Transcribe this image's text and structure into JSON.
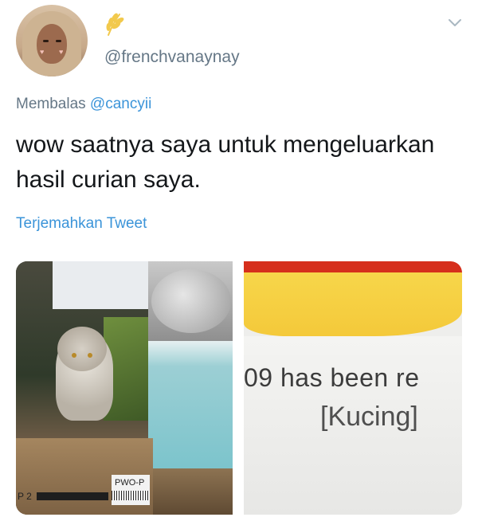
{
  "user": {
    "handle": "@frenchvanaynay",
    "avatar_icon": "profile-avatar",
    "badge_icon": "wheat-icon",
    "menu_icon": "chevron-down-icon"
  },
  "reply": {
    "prefix": "Membalas ",
    "mention": "@cancyii"
  },
  "tweet": {
    "text": "wow saatnya saya untuk mengeluarkan hasil curian saya."
  },
  "translate_label": "Terjemahkan Tweet",
  "media": {
    "left_photo": {
      "box_label": "PWO-P",
      "box_label2": "P 2"
    },
    "right_photo": {
      "line1": "09 has been re",
      "line2": "[Kucing]"
    }
  },
  "colors": {
    "link": "#3b94d9",
    "secondary": "#657786",
    "text": "#14171a",
    "badge": "#f2c94c"
  }
}
